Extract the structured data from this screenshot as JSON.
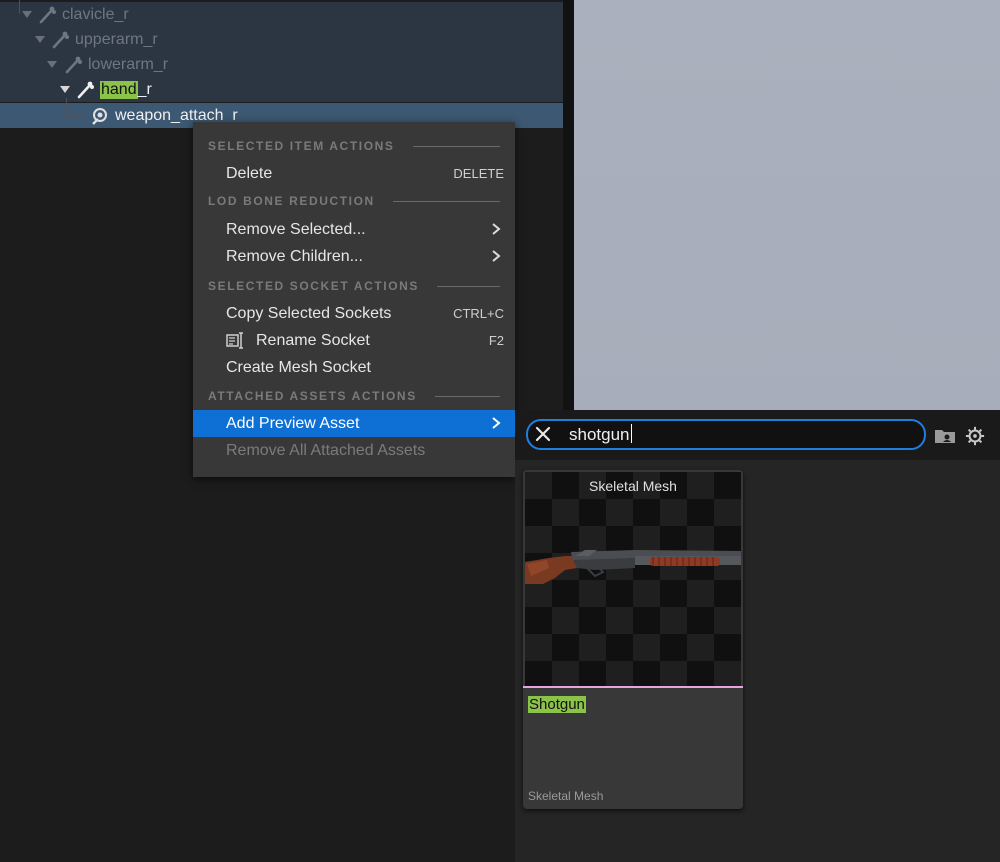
{
  "tree": {
    "nodes": [
      {
        "label": "clavicle_r",
        "highlight": ""
      },
      {
        "label": "upperarm_r",
        "highlight": ""
      },
      {
        "label": "lowerarm_r",
        "highlight": ""
      },
      {
        "label_prefix": "hand",
        "label_suffix": "_r"
      },
      {
        "label": "weapon_attach_r"
      }
    ]
  },
  "context_menu": {
    "sections": [
      "SELECTED ITEM ACTIONS",
      "LOD BONE REDUCTION",
      "SELECTED SOCKET ACTIONS",
      "ATTACHED ASSETS ACTIONS"
    ],
    "items": [
      {
        "label": "Delete",
        "shortcut": "DELETE"
      },
      {
        "label": "Remove Selected...",
        "submenu": true
      },
      {
        "label": "Remove Children...",
        "submenu": true
      },
      {
        "label": "Copy Selected Sockets",
        "shortcut": "CTRL+C"
      },
      {
        "label": "Rename Socket",
        "shortcut": "F2",
        "icon": "rename-icon"
      },
      {
        "label": "Create Mesh Socket"
      },
      {
        "label": "Add Preview Asset",
        "submenu": true,
        "active": true
      },
      {
        "label": "Remove All Attached Assets",
        "disabled": true
      }
    ]
  },
  "asset_picker": {
    "search_value": "shotgun",
    "asset": {
      "type_header": "Skeletal Mesh",
      "name": "Shotgun",
      "type_footer": "Skeletal Mesh",
      "type_color": "#e7a5e0"
    }
  },
  "colors": {
    "accent": "#0e70d4",
    "search_highlight": "#8bc34a",
    "selected_row": "#3d5873"
  }
}
